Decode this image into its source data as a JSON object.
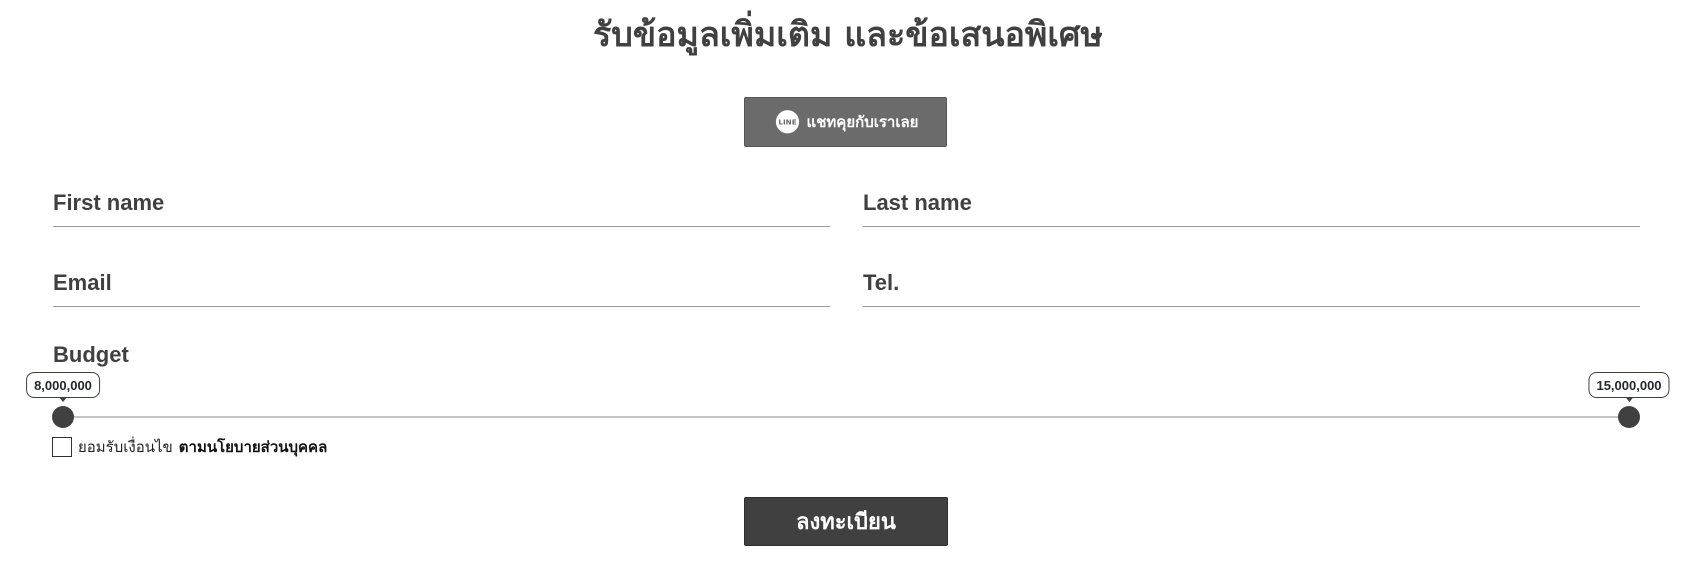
{
  "page_title": "รับข้อมูลเพิ่มเติม และข้อเสนอพิเศษ",
  "line_button": {
    "icon": "line-chat-icon",
    "icon_text": "LINE",
    "label": "แชทคุยกับเราเลย"
  },
  "form": {
    "first_name": {
      "placeholder": "First name",
      "value": ""
    },
    "last_name": {
      "placeholder": "Last name",
      "value": ""
    },
    "email": {
      "placeholder": "Email",
      "value": ""
    },
    "tel": {
      "placeholder": "Tel.",
      "value": ""
    },
    "budget": {
      "label": "Budget",
      "min_label": "8,000,000",
      "max_label": "15,000,000",
      "min_position": 0,
      "max_position": 1
    },
    "consent": {
      "checked": false,
      "text": "ยอมรับเงื่อนไข",
      "link_text": "ตามนโยบายส่วนบุคคล"
    },
    "submit_label": "ลงทะเบียน"
  },
  "colors": {
    "text": "#404040",
    "line_button_bg": "#6b6b6b",
    "submit_bg": "#404040",
    "underline": "#9a9a9a",
    "slider_track": "#c4c4c4"
  }
}
